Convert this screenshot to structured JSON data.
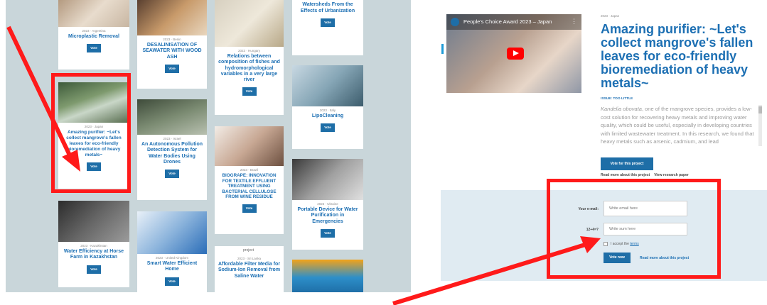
{
  "left": {
    "cards": [
      {
        "id": "microplastic",
        "year": "2023 · Argentina",
        "title": "Microplastic Removal",
        "vote": "Vote"
      },
      {
        "id": "desalination",
        "year": "2023 · Benin",
        "title": "DESALINISATION OF SEAWATER WITH WOOD ASH",
        "vote": "Vote"
      },
      {
        "id": "fishes",
        "year": "2023 · Hungary",
        "title": "Relations between composition of fishes and hydromorphological variables in a very large river",
        "vote": "Vote"
      },
      {
        "id": "watersheds",
        "year": "",
        "title": "Natural Solution to Protect Watersheds From the Effects of Urbanization",
        "vote": "Vote"
      },
      {
        "id": "purifier",
        "year": "2023 · Japan",
        "title": "Amazing purifier: ~Let's collect mangrove's fallen leaves for eco-friendly bioremediation of heavy metals~",
        "vote": "Vote"
      },
      {
        "id": "lipocleaning",
        "year": "2023 · Italy",
        "title": "LipoCleaning",
        "vote": "Vote"
      },
      {
        "id": "drones",
        "year": "2023 · Israel",
        "title": "An Autonomous Pollution Detection System for Water Bodies Using Drones",
        "vote": "Vote"
      },
      {
        "id": "biograpе",
        "year": "2023 · Brazil",
        "title": "BIOGRAPE: INNOVATION FOR TEXTILE EFFLUENT TREATMENT USING BACTERIAL CELLULOSE FROM WINE RESIDUE",
        "vote": "Vote"
      },
      {
        "id": "portable",
        "year": "2023 · Ukraine",
        "title": "Portable Device for Water Purification in Emergencies",
        "vote": "Vote"
      },
      {
        "id": "horsefarm",
        "year": "2023 · Kazakhstan",
        "title": "Water Efficiency at Horse Farm in Kazakhstan",
        "vote": "Vote"
      },
      {
        "id": "smartwater",
        "year": "2023 · United Kingdom",
        "title": "Smart Water Efficient Home",
        "vote": "Vote"
      },
      {
        "id": "filtermedia",
        "year": "2023 · Sri Lanka",
        "title": "Affordable Filter Media for Sodium-Ion Removal from Saline Water",
        "vote": "Vote",
        "img_alt": "project"
      }
    ]
  },
  "right": {
    "video_title": "People's Choice Award 2023 – Japan",
    "year": "2023 · Japan",
    "title": "Amazing purifier: ~Let's collect mangrove's fallen leaves for eco-friendly bioremediation of heavy metals~",
    "issue": "ISSUE: TOO LITTLE",
    "desc_species": "Kandelia obovata",
    "desc_rest": ", one of the mangrove species, provides a low-cost solution for recovering heavy metals and improving water quality, which could be useful, especially in developing countries with limited wastewater treatment. In this research, we found that heavy metals such as arsenic, cadmium, and lead",
    "vote_button": "Vote for this project",
    "link_read": "Read more about this project",
    "link_paper": "View research paper",
    "form": {
      "email_label": "Your e-mail:",
      "email_placeholder": "Write email here",
      "sum_label": "12+4=?",
      "sum_placeholder": "Write sum here",
      "accept_prefix": "I accept the ",
      "accept_terms": "terms",
      "vote_now": "Vote now",
      "read_more": "Read more about this project"
    }
  },
  "colors": {
    "accent": "#1e6ea7",
    "title": "#1c6fb3",
    "annotation": "#ff1a1a",
    "panel_bg": "#c9d6da",
    "form_bg": "#e0ebf2"
  }
}
